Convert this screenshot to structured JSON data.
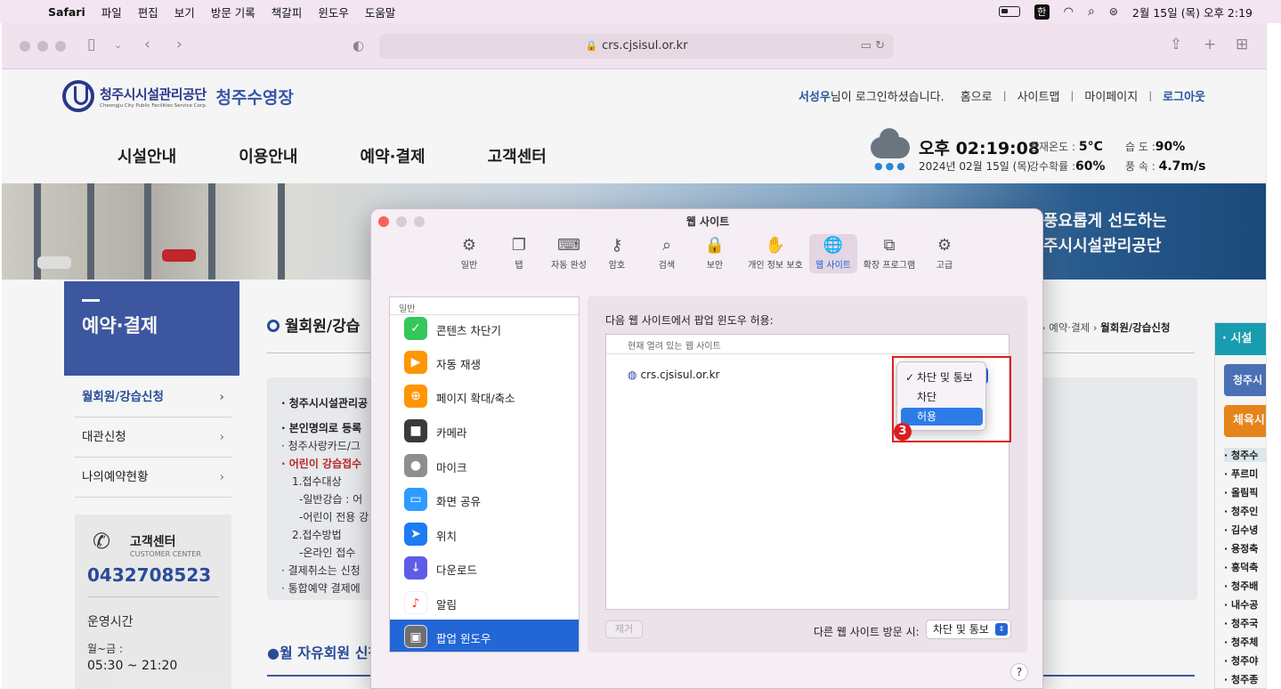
{
  "menubar": {
    "app": "Safari",
    "items": [
      "파일",
      "편집",
      "보기",
      "방문 기록",
      "책갈피",
      "윈도우",
      "도움말"
    ],
    "ime": "한",
    "clock": "2월 15일 (목) 오후 2:19"
  },
  "browser": {
    "url": "crs.cjsisul.or.kr"
  },
  "site": {
    "logo_ko": "청주시시설관리공단",
    "logo_en": "Cheongju City Public Facilities Service Corp.",
    "logo_sub": "청주수영장",
    "user_name": "서성우",
    "login_msg": "님이 로그인하셨습니다.",
    "top_links": [
      "홈으로",
      "사이트맵",
      "마이페이지"
    ],
    "logout": "로그아웃",
    "main_nav": [
      "시설안내",
      "이용안내",
      "예약·결제",
      "고객센터"
    ],
    "weather": {
      "time": "오후 02:19:08",
      "date": "2024년 02월 15일 (목)",
      "temp_label": "현재온도 :",
      "temp": "5°C",
      "humidity_label": "습 도 :",
      "humidity": "90%",
      "precip_label": "강수확률 :",
      "precip": "60%",
      "wind_label": "풍 속 :",
      "wind": "4.7m/s"
    },
    "banner_line1": "풍요롭게 선도하는",
    "banner_line2": "주시시설관리공단",
    "lnb_title": "예약·결제",
    "lnb_items": [
      "월회원/강습신청",
      "대관신청",
      "나의예약현황"
    ],
    "customer_center": {
      "title": "고객센터",
      "en": "CUSTOMER CENTER",
      "phone": "0432708523",
      "hours_title": "운영시간",
      "days": "월~금 :",
      "range": "05:30 ~ 21:20"
    },
    "content_title": "월회원/강습",
    "breadcrumb_mid": "예약·결제",
    "breadcrumb_cur": "월회원/강습신청",
    "info_lines": [
      "· 청주시시설관리공",
      "· 본인명의로 등록",
      "· 청주사랑카드/그",
      "· 어린이 강습접수",
      "1.접수대상",
      "-일반강습 : 어",
      "-어린이 전용 강",
      "2.접수방법",
      "-온라인 접수",
      "· 결제취소는 신청",
      "· 통합예약 결제에"
    ],
    "section2": "●월 자유회원 신청",
    "right_panel": {
      "head": "· 시설",
      "btn1": "청주시",
      "btn2": "체육시",
      "items": [
        "· 청주수",
        "· 푸르미",
        "· 올림픽",
        "· 청주인",
        "· 김수녕",
        "· 용정축",
        "· 흥덕축",
        "· 청주배",
        "· 내수공",
        "· 청주국",
        "· 청주체",
        "· 청주야",
        "· 청주종"
      ]
    }
  },
  "prefs": {
    "title": "웹 사이트",
    "tabs": [
      {
        "label": "일반",
        "icon": "gear-icon",
        "glyph": "⚙"
      },
      {
        "label": "탭",
        "icon": "tabs-icon",
        "glyph": "❐"
      },
      {
        "label": "자동 완성",
        "icon": "autofill-icon",
        "glyph": "⌨"
      },
      {
        "label": "암호",
        "icon": "key-icon",
        "glyph": "⚷"
      },
      {
        "label": "검색",
        "icon": "search-icon",
        "glyph": "⌕"
      },
      {
        "label": "보안",
        "icon": "lock-icon",
        "glyph": "🔒"
      },
      {
        "label": "개인 정보 보호",
        "icon": "hand-icon",
        "glyph": "✋"
      },
      {
        "label": "웹 사이트",
        "icon": "globe-icon",
        "glyph": "🌐"
      },
      {
        "label": "확장 프로그램",
        "icon": "puzzle-icon",
        "glyph": "⧉"
      },
      {
        "label": "고급",
        "icon": "gears-icon",
        "glyph": "⚙"
      }
    ],
    "active_tab": "웹 사이트",
    "sidebar_head": "일반",
    "sidebar": [
      {
        "label": "콘텐츠 차단기",
        "icon": "content-blocker-icon",
        "color": "#34c759",
        "glyph": "✓"
      },
      {
        "label": "자동 재생",
        "icon": "autoplay-icon",
        "color": "#ff9500",
        "glyph": "▶"
      },
      {
        "label": "페이지 확대/축소",
        "icon": "zoom-icon",
        "color": "#ff9500",
        "glyph": "⊕"
      },
      {
        "label": "카메라",
        "icon": "camera-icon",
        "color": "#3a3a3c",
        "glyph": "■"
      },
      {
        "label": "마이크",
        "icon": "microphone-icon",
        "color": "#8e8e93",
        "glyph": "●"
      },
      {
        "label": "화면 공유",
        "icon": "screen-share-icon",
        "color": "#2f9bff",
        "glyph": "▭"
      },
      {
        "label": "위치",
        "icon": "location-icon",
        "color": "#1c7cf2",
        "glyph": "➤"
      },
      {
        "label": "다운로드",
        "icon": "download-icon",
        "color": "#5e5ce6",
        "glyph": "↓"
      },
      {
        "label": "알림",
        "icon": "bell-icon",
        "color": "#ff3b30",
        "glyph": "♪"
      },
      {
        "label": "팝업 윈도우",
        "icon": "popup-window-icon",
        "color": "#6e6e73",
        "glyph": "▣"
      }
    ],
    "selected_sidebar": "팝업 윈도우",
    "pane_label": "다음 웹 사이트에서 팝업 윈도우 허용:",
    "list_head": "현재 열려 있는 웹 사이트",
    "site": "crs.cjsisul.or.kr",
    "remove_btn": "제거",
    "other_label": "다른 웹 사이트 방문 시:",
    "other_value": "차단 및 통보",
    "help": "?"
  },
  "popup_menu": {
    "options": [
      "차단 및 통보",
      "차단",
      "허용"
    ],
    "checked": "차단 및 통보",
    "highlighted": "허용",
    "check_glyph": "✓"
  },
  "annotation": {
    "step": "3",
    "color": "#e0201e"
  }
}
